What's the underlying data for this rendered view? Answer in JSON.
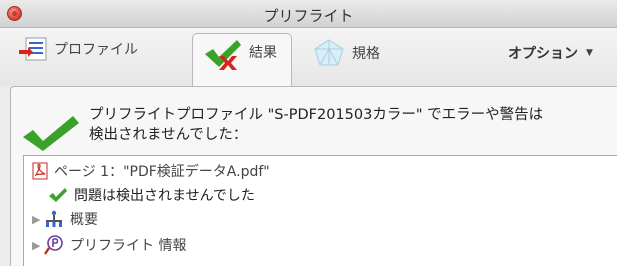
{
  "window": {
    "title": "プリフライト"
  },
  "tabs": {
    "profile": "プロファイル",
    "results": "結果",
    "standards": "規格",
    "options": "オプション"
  },
  "summary": {
    "line1": "プリフライトプロファイル \"S-PDF201503カラー\" でエラーや警告は",
    "line2": "検出されませんでした："
  },
  "tree": {
    "page": "ページ 1：\"PDF検証データA.pdf\"",
    "no_issues": "問題は検出されませんでした",
    "overview": "概要",
    "preflight_info": "プリフライト 情報"
  },
  "colors": {
    "check_green": "#3aa22a",
    "error_red": "#d4261e",
    "pdf_red": "#c8281e"
  }
}
